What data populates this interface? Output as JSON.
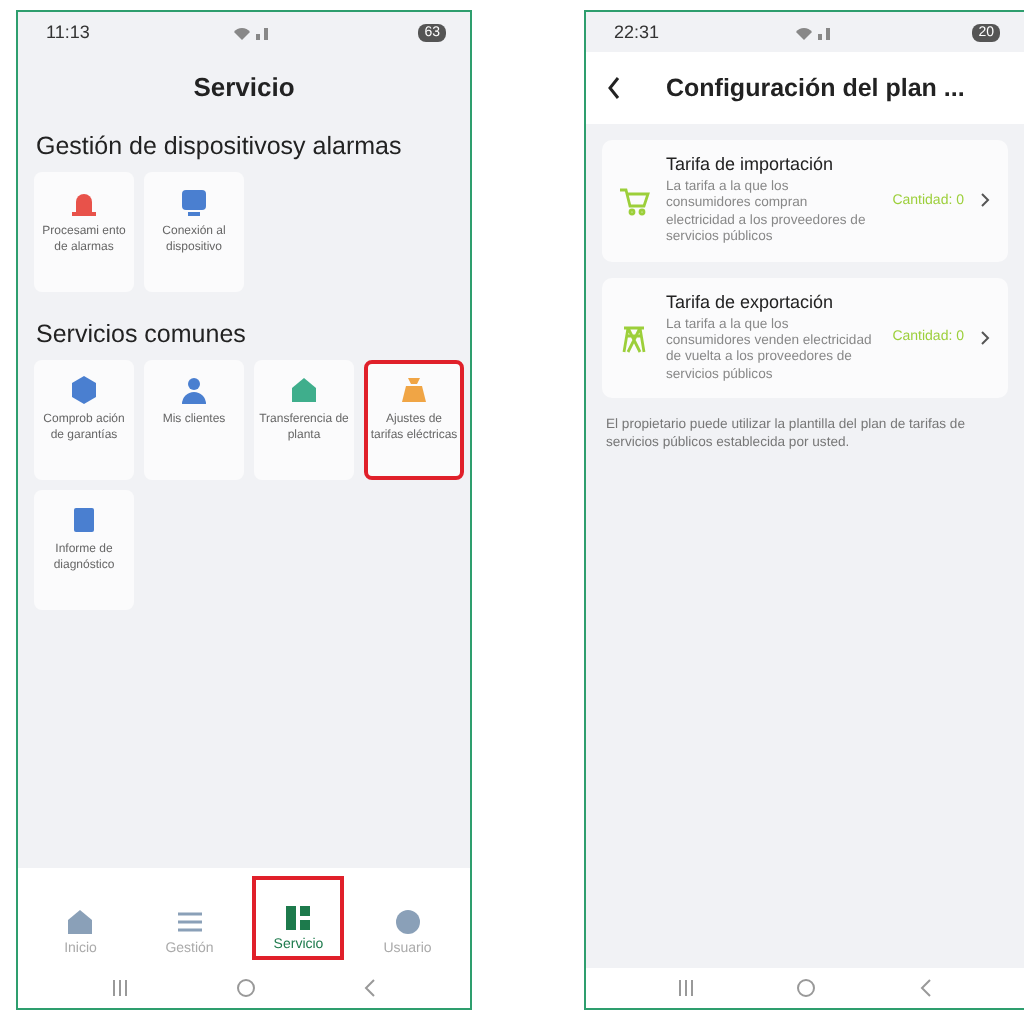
{
  "left_phone": {
    "status_bar": {
      "time": "11:13",
      "battery": "63"
    },
    "title": "Servicio",
    "sections": [
      {
        "title": "Gestión de dispositivosy alarmas",
        "tiles": [
          {
            "kind": "alarm",
            "label": "Procesami ento de alarmas",
            "color": "#e8524a",
            "highlighted": false
          },
          {
            "kind": "monitor",
            "label": "Conexión al dispositivo",
            "color": "#4a7fd0",
            "highlighted": false
          }
        ]
      },
      {
        "title": "Servicios comunes",
        "tiles": [
          {
            "kind": "shield",
            "label": "Comprob ación de garantías",
            "color": "#4a7fd0",
            "highlighted": false
          },
          {
            "kind": "person",
            "label": "Mis clientes",
            "color": "#4a7fd0",
            "highlighted": false
          },
          {
            "kind": "house",
            "label": "Transferencia de planta",
            "color": "#3fae8c",
            "highlighted": false
          },
          {
            "kind": "bag",
            "label": "Ajustes de tarifas eléctricas",
            "color": "#f0a545",
            "highlighted": true
          },
          {
            "kind": "report",
            "label": "Informe de diagnóstico",
            "color": "#4a7fd0",
            "highlighted": false
          }
        ]
      }
    ],
    "nav": [
      {
        "kind": "home",
        "label": "Inicio",
        "selected": false,
        "highlighted": false
      },
      {
        "kind": "list",
        "label": "Gestión",
        "selected": false,
        "highlighted": false
      },
      {
        "kind": "grid",
        "label": "Servicio",
        "selected": true,
        "highlighted": true
      },
      {
        "kind": "user",
        "label": "Usuario",
        "selected": false,
        "highlighted": false
      }
    ]
  },
  "right_phone": {
    "status_bar": {
      "time": "22:31",
      "battery": "20"
    },
    "title": "Configuración del plan ...",
    "cards": [
      {
        "kind": "cart",
        "title": "Tarifa de importación",
        "description": "La tarifa a la que los consumidores compran electricidad a los proveedores de servicios públicos",
        "count": "Cantidad: 0"
      },
      {
        "kind": "tower",
        "title": "Tarifa de exportación",
        "description": "La tarifa a la que los consumidores venden electricidad de vuelta a los proveedores de servicios públicos",
        "count": "Cantidad: 0"
      }
    ],
    "note": "El propietario puede utilizar la plantilla del plan de tarifas de servicios públicos establecida por usted."
  }
}
